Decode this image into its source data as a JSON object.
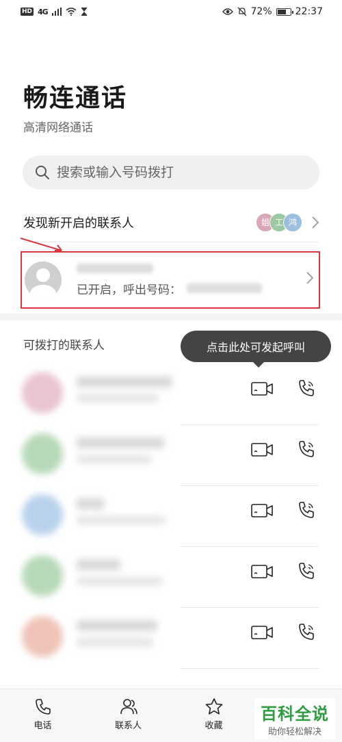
{
  "status_bar": {
    "hd": "HD",
    "network": "4G",
    "battery_percent": "72%",
    "battery_level": 0.72,
    "time": "22:37"
  },
  "header": {
    "title": "畅连通话",
    "subtitle": "高清网络通话"
  },
  "search": {
    "placeholder": "搜索或输入号码拨打"
  },
  "discover": {
    "label": "发现新开启的联系人",
    "avatars": [
      {
        "char": "姐",
        "color": "#d9a8b8"
      },
      {
        "char": "工",
        "color": "#9cc8a4"
      },
      {
        "char": "鸿",
        "color": "#9cbfe0"
      }
    ]
  },
  "highlight_contact": {
    "status_text": "已开启，呼出号码："
  },
  "contacts_section": {
    "label": "可拨打的联系人"
  },
  "tooltip": {
    "text": "点击此处可发起呼叫"
  },
  "contacts": [
    {
      "color": "#e9c4d1"
    },
    {
      "color": "#b8d9b8"
    },
    {
      "color": "#b9d2ec"
    },
    {
      "color": "#b8d9b8"
    },
    {
      "color": "#f0c4b8"
    }
  ],
  "bottom_nav": {
    "items": [
      {
        "label": "电话"
      },
      {
        "label": "联系人"
      },
      {
        "label": "收藏"
      },
      {
        "label": ""
      }
    ]
  },
  "watermark": {
    "title": "百科全说",
    "subtitle": "助你轻松解决"
  },
  "colors": {
    "highlight_border": "#d9363e",
    "tooltip_bg": "#444444",
    "watermark_green": "#2e9c3f"
  }
}
